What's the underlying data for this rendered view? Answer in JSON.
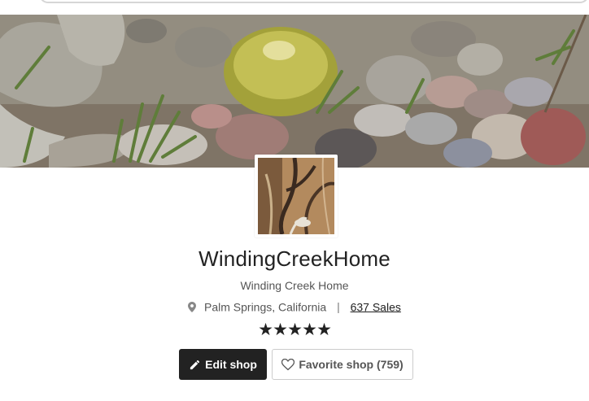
{
  "header": {
    "search_placeholder": ""
  },
  "shop": {
    "name": "WindingCreekHome",
    "subtitle": "Winding Creek Home",
    "location": "Palm Springs, California",
    "separator": "|",
    "sales": "637 Sales",
    "rating_stars": [
      "★",
      "★",
      "★",
      "★",
      "★"
    ],
    "rating": 5
  },
  "actions": {
    "edit_label": "Edit shop",
    "favorite_label": "Favorite shop (759)"
  },
  "icons": {
    "pin": "location-pin-icon",
    "pencil": "pencil-icon",
    "heart": "heart-outline-icon"
  },
  "colors": {
    "primary_button": "#222222",
    "text": "#222222",
    "muted_text": "#555555",
    "border": "#cccccc"
  }
}
